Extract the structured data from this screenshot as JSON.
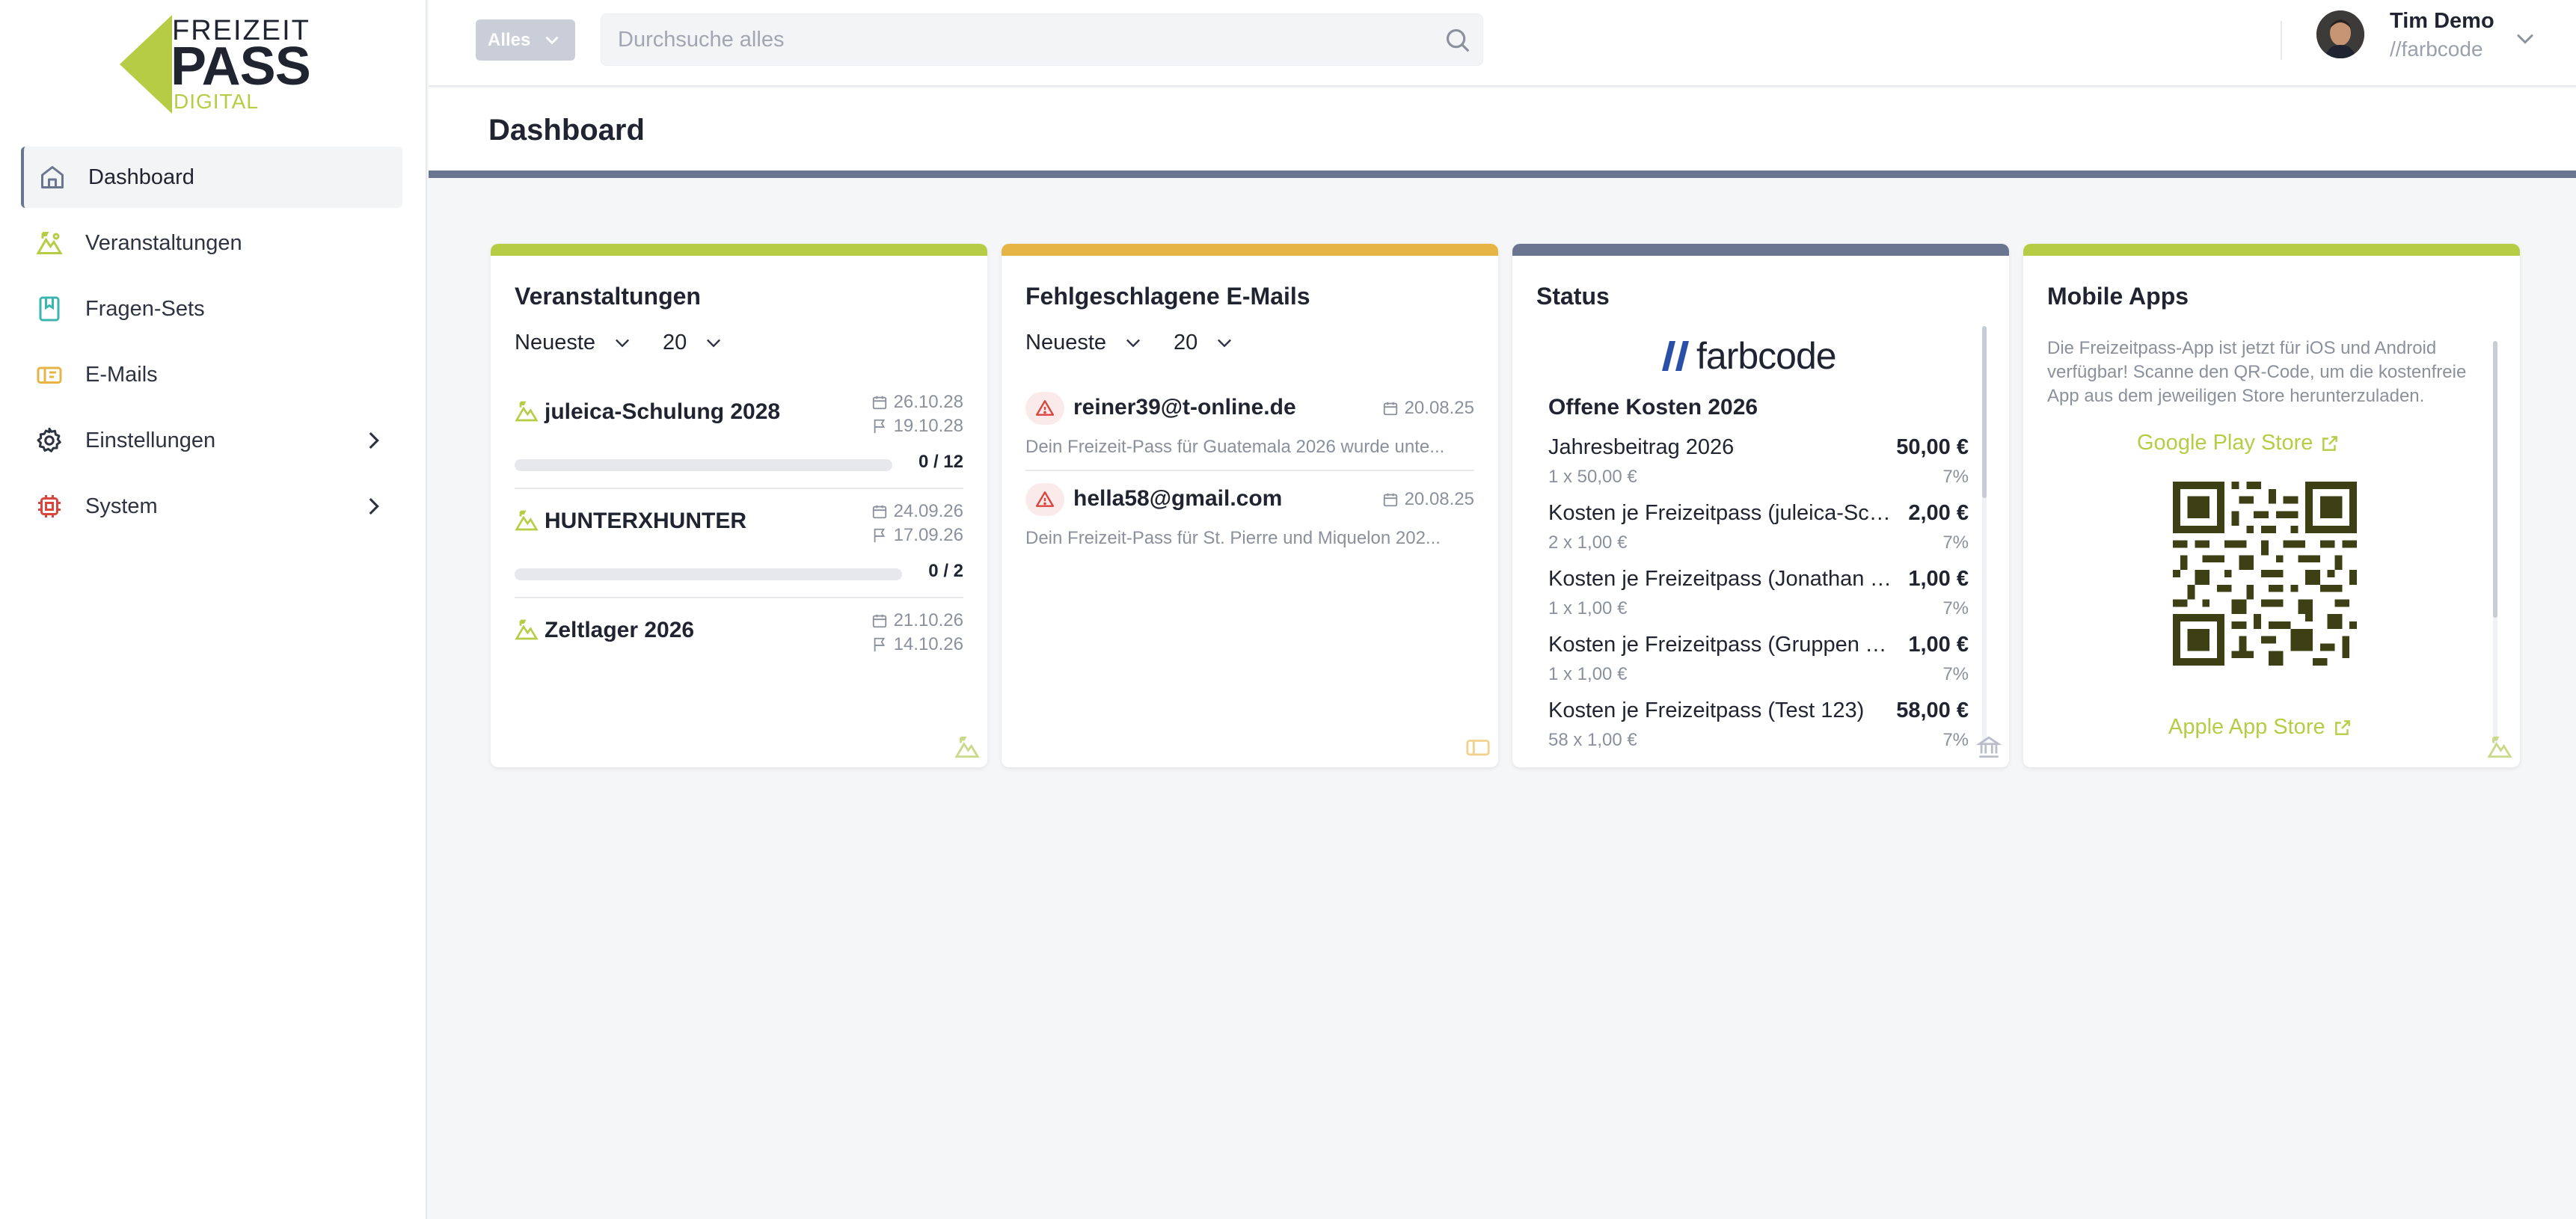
{
  "brand": {
    "line1": "FREIZEIT",
    "line2": "PASS",
    "line3": "DIGITAL",
    "accent": "#b6cc45"
  },
  "sidebar": {
    "items": [
      {
        "label": "Dashboard",
        "icon": "home-icon",
        "active": true
      },
      {
        "label": "Veranstaltungen",
        "icon": "event-icon"
      },
      {
        "label": "Fragen-Sets",
        "icon": "bookmark-icon"
      },
      {
        "label": "E-Mails",
        "icon": "ticket-icon"
      },
      {
        "label": "Einstellungen",
        "icon": "gear-icon",
        "expandable": true
      },
      {
        "label": "System",
        "icon": "chip-icon",
        "expandable": true
      }
    ]
  },
  "topbar": {
    "filter_label": "Alles",
    "search_placeholder": "Durchsuche alles",
    "user_name": "Tim Demo",
    "user_org": "//farbcode"
  },
  "page": {
    "title": "Dashboard"
  },
  "cards": {
    "events": {
      "title": "Veranstaltungen",
      "sort": "Neueste",
      "count": "20",
      "color": "#b6cc45",
      "items": [
        {
          "name": "juleica-Schulung 2028",
          "start": "26.10.28",
          "end": "19.10.28",
          "progress": "0 / 12",
          "fill": 0
        },
        {
          "name": "HUNTERXHUNTER",
          "start": "24.09.26",
          "end": "17.09.26",
          "progress": "0 / 2",
          "fill": 0
        },
        {
          "name": "Zeltlager 2026",
          "start": "21.10.26",
          "end": "14.10.26"
        }
      ]
    },
    "emails": {
      "title": "Fehlgeschlagene E-Mails",
      "sort": "Neueste",
      "count": "20",
      "color": "#e5b444",
      "items": [
        {
          "address": "reiner39@t-online.de",
          "date": "20.08.25",
          "desc": "Dein Freizeit-Pass für Guatemala 2026 wurde unte..."
        },
        {
          "address": "hella58@gmail.com",
          "date": "20.08.25",
          "desc": "Dein Freizeit-Pass für St. Pierre und Miquelon 202..."
        }
      ]
    },
    "status": {
      "title": "Status",
      "logo_text": "farbcode",
      "subtitle": "Offene Kosten 2026",
      "color": "#6a7590",
      "rows": [
        {
          "name": "Jahresbeitrag 2026",
          "amount": "50,00 €",
          "sub": "1 x 50,00 €",
          "pct": "7%"
        },
        {
          "name": "Kosten je Freizeitpass (juleica-Sch...",
          "amount": "2,00 €",
          "sub": "2 x 1,00 €",
          "pct": "7%"
        },
        {
          "name": "Kosten je Freizeitpass (Jonathan T...",
          "amount": "1,00 €",
          "sub": "1 x 1,00 €",
          "pct": "7%"
        },
        {
          "name": "Kosten je Freizeitpass (Gruppen T...",
          "amount": "1,00 €",
          "sub": "1 x 1,00 €",
          "pct": "7%"
        },
        {
          "name": "Kosten je Freizeitpass (Test 123)",
          "amount": "58,00 €",
          "sub": "58 x 1,00 €",
          "pct": "7%"
        }
      ]
    },
    "apps": {
      "title": "Mobile Apps",
      "color": "#b6cc45",
      "desc": "Die Freizeitpass-App ist jetzt für iOS und Android verfügbar! Scanne den QR-Code, um die kostenfreie App aus dem jeweiligen Store herunterzuladen.",
      "google_label": "Google Play Store",
      "apple_label": "Apple App Store"
    }
  }
}
